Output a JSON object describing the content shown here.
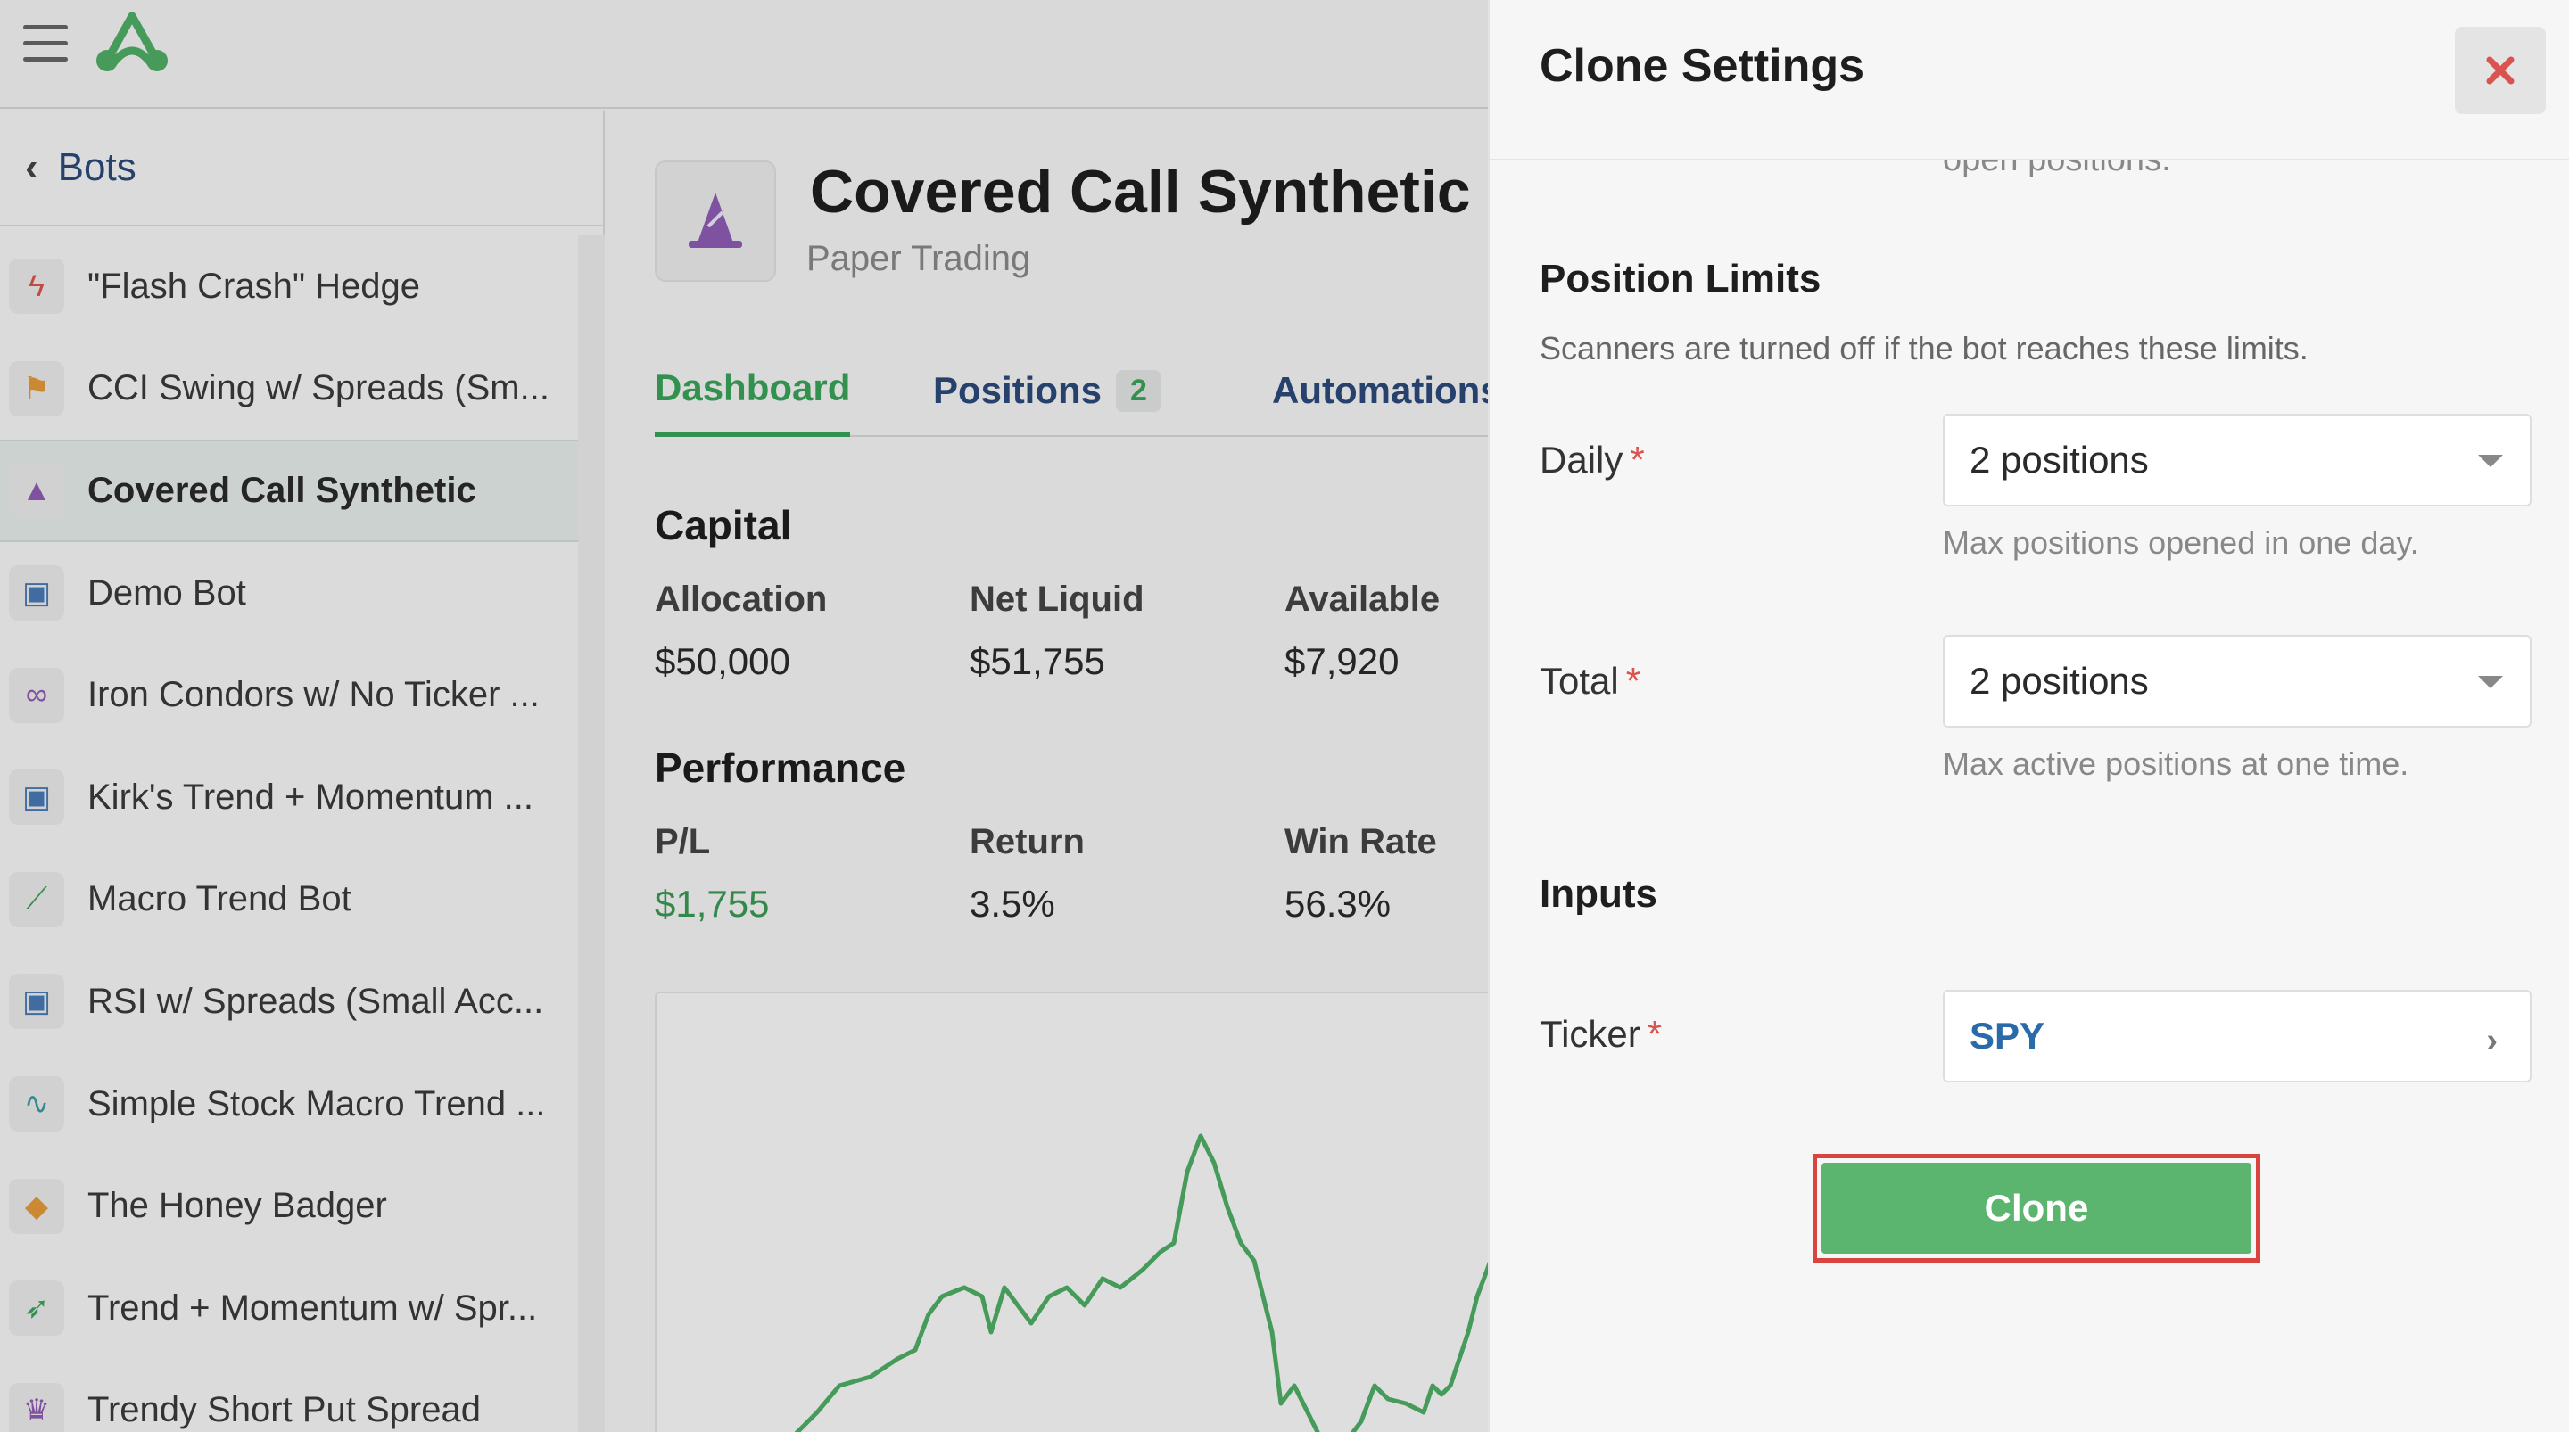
{
  "topbar": {
    "menu_icon": "hamburger-icon",
    "logo_icon": "brand-logo-icon"
  },
  "sidebar": {
    "back_label": "Bots",
    "items": [
      {
        "label": "\"Flash Crash\" Hedge",
        "icon": "lightning-icon",
        "color": "#d9534f"
      },
      {
        "label": "CCI Swing w/ Spreads (Sm...",
        "icon": "flag-icon",
        "color": "#e59a3a"
      },
      {
        "label": "Covered Call Synthetic",
        "icon": "wizard-hat-icon",
        "color": "#8e5bb5"
      },
      {
        "label": "Demo Bot",
        "icon": "robot-icon",
        "color": "#4a7ab5"
      },
      {
        "label": "Iron Condors w/ No Ticker ...",
        "icon": "condor-icon",
        "color": "#8e5bb5"
      },
      {
        "label": "Kirk's Trend + Momentum ...",
        "icon": "robot-icon",
        "color": "#4a7ab5"
      },
      {
        "label": "Macro Trend Bot",
        "icon": "line-chart-icon",
        "color": "#3aa35a"
      },
      {
        "label": "RSI w/ Spreads (Small Acc...",
        "icon": "robot-icon",
        "color": "#4a7ab5"
      },
      {
        "label": "Simple Stock Macro Trend ...",
        "icon": "pulse-icon",
        "color": "#3a9aa3"
      },
      {
        "label": "The Honey Badger",
        "icon": "badger-icon",
        "color": "#e59a3a"
      },
      {
        "label": "Trend + Momentum w/ Spr...",
        "icon": "rocket-icon",
        "color": "#3aa35a"
      },
      {
        "label": "Trendy Short Put Spread",
        "icon": "crown-icon",
        "color": "#8e5bb5"
      }
    ]
  },
  "main": {
    "title": "Covered Call Synthetic",
    "subtitle": "Paper Trading",
    "tabs": [
      {
        "label": "Dashboard"
      },
      {
        "label": "Positions",
        "badge": "2"
      },
      {
        "label": "Automations"
      }
    ],
    "capital": {
      "title": "Capital",
      "stats": [
        {
          "label": "Allocation",
          "value": "$50,000"
        },
        {
          "label": "Net Liquid",
          "value": "$51,755"
        },
        {
          "label": "Available",
          "value": "$7,920"
        }
      ]
    },
    "performance": {
      "title": "Performance",
      "stats": [
        {
          "label": "P/L",
          "value": "$1,755"
        },
        {
          "label": "Return",
          "value": "3.5%"
        },
        {
          "label": "Win Rate",
          "value": "56.3%"
        }
      ]
    }
  },
  "panel": {
    "title": "Clone Settings",
    "cut_text": "open positions.",
    "position_limits": {
      "title": "Position Limits",
      "description": "Scanners are turned off if the bot reaches these limits.",
      "daily": {
        "label": "Daily",
        "required": "*",
        "value": "2 positions",
        "hint": "Max positions opened in one day."
      },
      "total": {
        "label": "Total",
        "required": "*",
        "value": "2 positions",
        "hint": "Max active positions at one time."
      }
    },
    "inputs": {
      "title": "Inputs",
      "ticker": {
        "label": "Ticker",
        "required": "*",
        "value": "SPY"
      }
    },
    "clone_button": "Clone",
    "colors": {
      "accent_green": "#5cb56e",
      "highlight_red": "#d9453e",
      "close_red": "#d9534f"
    }
  }
}
